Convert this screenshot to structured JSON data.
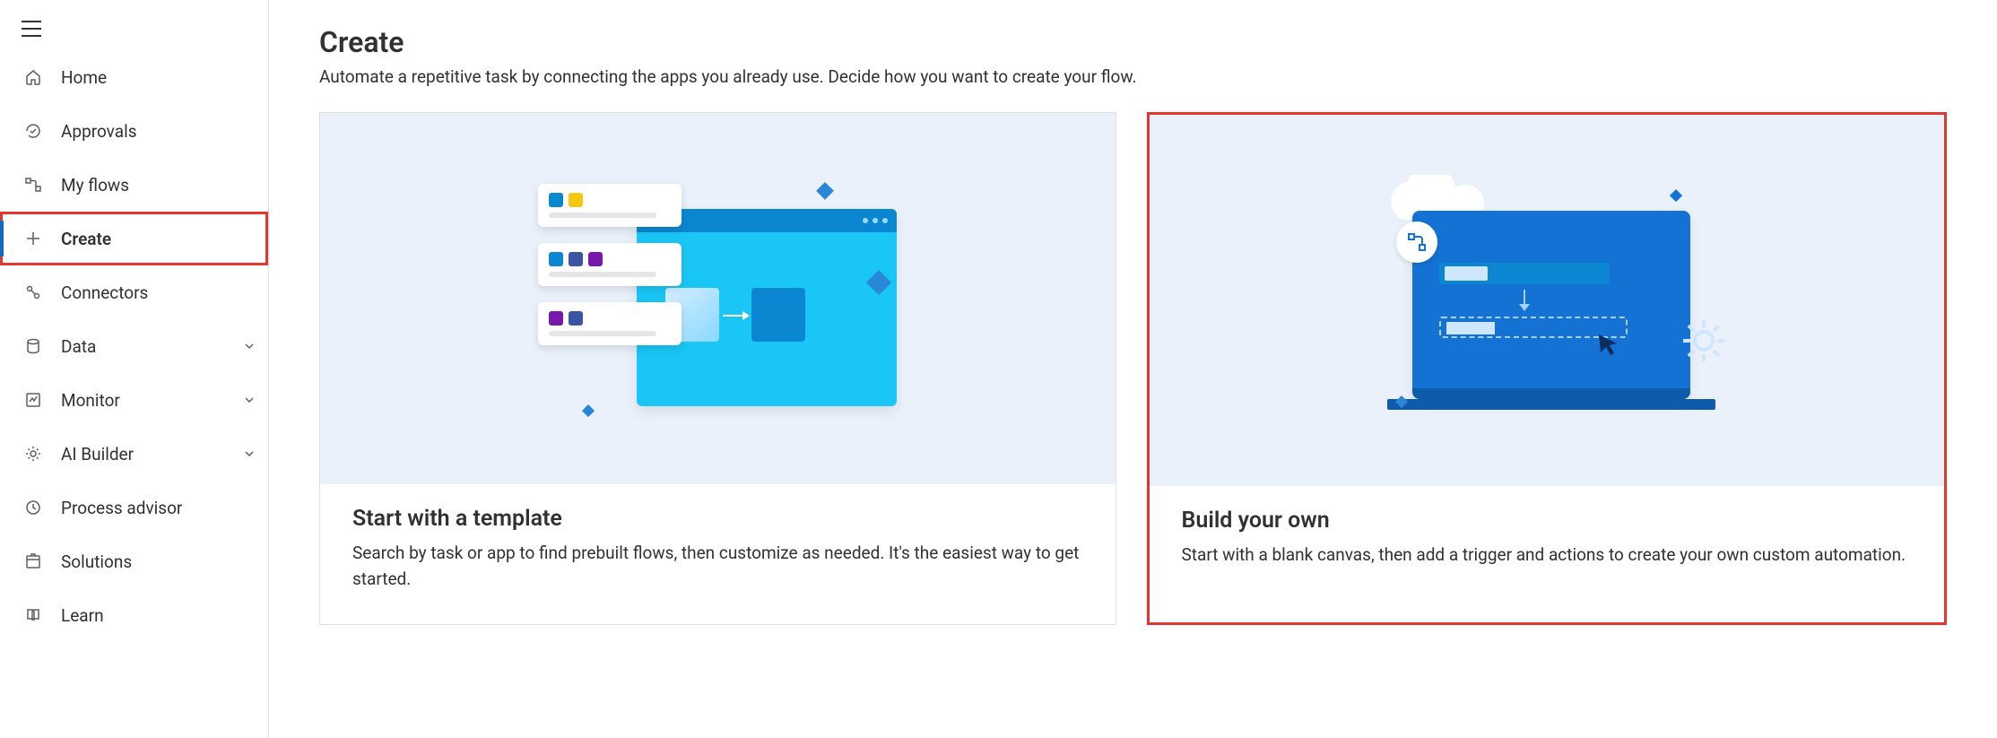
{
  "sidebar": {
    "items": [
      {
        "label": "Home"
      },
      {
        "label": "Approvals"
      },
      {
        "label": "My flows"
      },
      {
        "label": "Create"
      },
      {
        "label": "Connectors"
      },
      {
        "label": "Data"
      },
      {
        "label": "Monitor"
      },
      {
        "label": "AI Builder"
      },
      {
        "label": "Process advisor"
      },
      {
        "label": "Solutions"
      },
      {
        "label": "Learn"
      }
    ]
  },
  "page": {
    "title": "Create",
    "subtitle": "Automate a repetitive task by connecting the apps you already use. Decide how you want to create your flow."
  },
  "cards": {
    "template": {
      "title": "Start with a template",
      "desc": "Search by task or app to find prebuilt flows, then customize as needed. It's the easiest way to get started."
    },
    "build": {
      "title": "Build your own",
      "desc": "Start with a blank canvas, then add a trigger and actions to create your own custom automation."
    }
  }
}
